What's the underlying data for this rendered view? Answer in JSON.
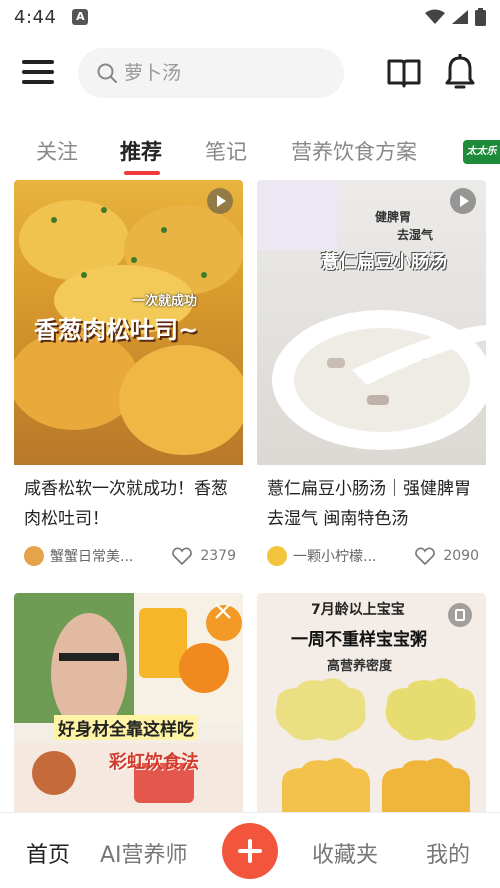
{
  "status_bar": {
    "time": "4:44",
    "app_icon_glyph": "A"
  },
  "search": {
    "placeholder": "萝卜汤"
  },
  "tabs": [
    {
      "label": "关注",
      "active": false
    },
    {
      "label": "推荐",
      "active": true
    },
    {
      "label": "笔记",
      "active": false
    },
    {
      "label": "营养饮食方案",
      "active": false
    }
  ],
  "brand_badge": "太太乐",
  "feed": [
    {
      "title": "咸香松软一次就成功！香葱肉松吐司！",
      "author": "蟹蟹日常美...",
      "likes": "2379",
      "type": "video",
      "overlay_small": "一次就成功",
      "overlay_big": "香葱肉松吐司~"
    },
    {
      "title": "薏仁扁豆小肠汤｜强健脾胃去湿气 闽南特色汤",
      "author": "一颗小柠檬...",
      "likes": "2090",
      "type": "video",
      "overlay_a": "健脾胃",
      "overlay_b": "去湿气",
      "overlay_big": "薏仁扁豆小肠汤"
    },
    {
      "type": "video",
      "overlay_a": "好身材全靠这样吃",
      "overlay_b": "彩虹饮食法"
    },
    {
      "type": "note",
      "overlay_a": "7月龄以上宝宝",
      "overlay_b": "一周不重样宝宝粥",
      "overlay_c": "高营养密度"
    }
  ],
  "bottom_nav": {
    "home": "首页",
    "ai": "AI营养师",
    "favorites": "收藏夹",
    "mine": "我的"
  },
  "colors": {
    "accent": "#ee3b3b",
    "add_button": "#f2553b",
    "brand": "#1f8a3a"
  }
}
